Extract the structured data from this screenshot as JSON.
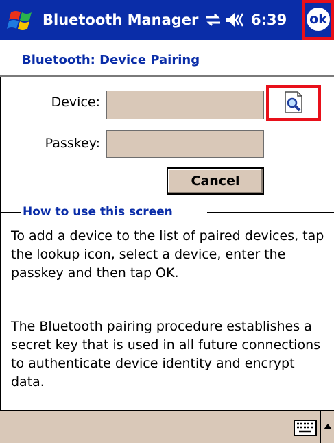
{
  "titlebar": {
    "start_icon": "windows-flag-icon",
    "title": "Bluetooth Manager",
    "connectivity_icon": "connectivity-arrows-icon",
    "volume_icon": "speaker-icon",
    "time": "6:39",
    "ok_label": "ok"
  },
  "page": {
    "title": "Bluetooth: Device Pairing"
  },
  "form": {
    "device_label": "Device:",
    "device_value": "",
    "passkey_label": "Passkey:",
    "passkey_value": "",
    "lookup_icon": "lookup-icon",
    "cancel_label": "Cancel"
  },
  "help": {
    "heading": "How to use this screen",
    "paragraph1": "To add a device to the list of paired devices, tap the lookup icon, select a device, enter the passkey and then tap OK.",
    "paragraph2": "The Bluetooth pairing procedure establishes a secret key that is used in all future connections to authenticate device identity and encrypt data."
  },
  "bottombar": {
    "keyboard_icon": "keyboard-icon",
    "sip_arrow_icon": "up-arrow-icon"
  },
  "colors": {
    "titlebar_bg": "#0a2da8",
    "accent_text": "#0a2da8",
    "control_bg": "#d9c8b8",
    "highlight_red": "#e8101a"
  }
}
